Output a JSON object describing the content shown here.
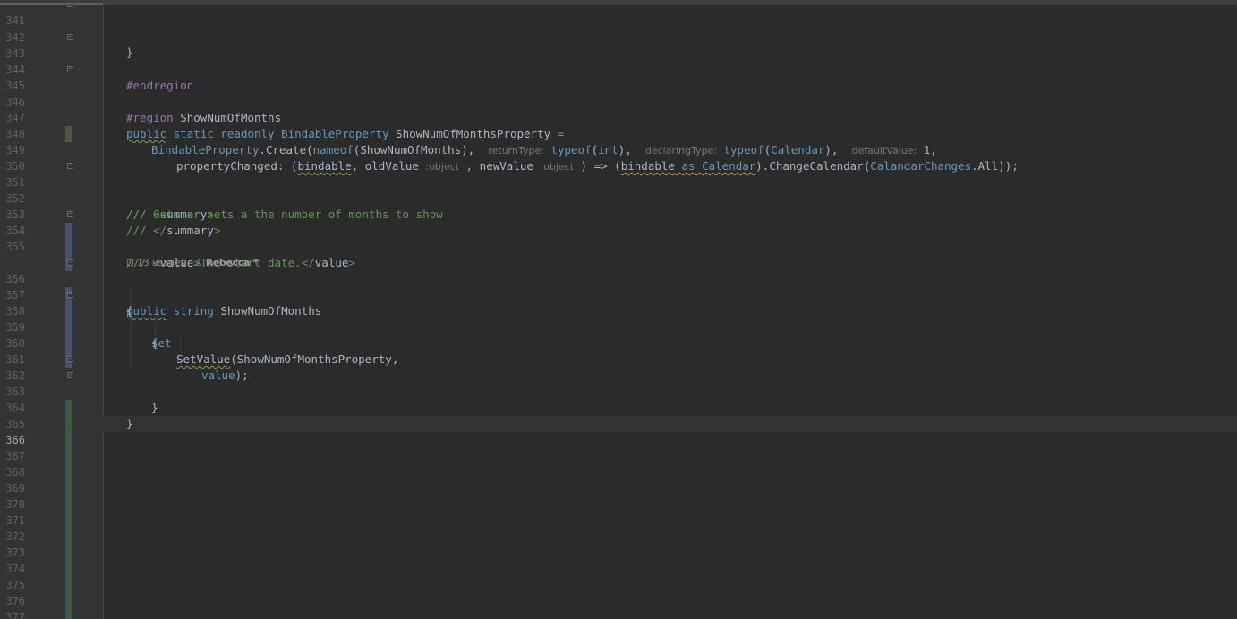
{
  "gutter": {
    "line_numbers": [
      "341",
      "342",
      "343",
      "344",
      "345",
      "346",
      "347",
      "348",
      "349",
      "350",
      "351",
      "352",
      "353",
      "354",
      "355",
      "356",
      "357",
      "358",
      "359",
      "360",
      "361",
      "362",
      "363",
      "364",
      "365",
      "366",
      "367",
      "368",
      "369",
      "370",
      "371",
      "372",
      "373",
      "374",
      "375",
      "376",
      "377",
      "378"
    ],
    "current_line": "366"
  },
  "code": {
    "l341": "}",
    "l343": "#endregion",
    "l345_kw": "#region",
    "l345_name": " ShowNumOfMonths",
    "l347_public": "public",
    "l347_static": " static",
    "l347_readonly": " readonly",
    "l347_type": " BindableProperty",
    "l347_name": " ShowNumOfMonthsProperty",
    "l347_eq": " =",
    "l348_cls": "BindableProperty",
    "l348_create": ".Create(",
    "l348_nameof": "nameof",
    "l348_arg": "(ShowNumOfMonths),",
    "l348_hint1": "returnType:",
    "l348_typeof1": "typeof",
    "l348_int_open": "(",
    "l348_int": "int",
    "l348_int_close": "),",
    "l348_hint2": "declaringType:",
    "l348_typeof2": "typeof",
    "l348_cal_open": "(",
    "l348_cal": "Calendar",
    "l348_cal_close": "),",
    "l348_hint3": "defaultValue:",
    "l348_default": "1",
    "l348_comma": ",",
    "l349_prop": "propertyChanged: (",
    "l349_bindable": "bindable",
    "l349_old": ", oldValue",
    "l349_hint_old": ":object",
    "l349_new": " , newValue",
    "l349_hint_new": ":object",
    "l349_arrow": " ) => (",
    "l349_bindable2": "bindable",
    "l349_as": "as",
    "l349_calendar": "Calendar",
    "l349_change": ").ChangeCalendar(",
    "l349_changes": "CalandarChanges",
    "l349_all": ".All));",
    "l351_slash": "/// ",
    "l351_tag": "<summary>",
    "l351_open": "<",
    "l351_tagname": "summary",
    "l351_close": ">",
    "l352": "/// Gets or sets a the number of months to show",
    "l353_slash": "/// ",
    "l353_open": "</",
    "l353_tagname": "summary",
    "l353_close": ">",
    "l354_slash": "/// ",
    "l354_open": "<",
    "l354_tagname": "value",
    "l354_close": ">",
    "l354_text": "The start date.",
    "l354_open2": "</",
    "l354_tagname2": "value",
    "l354_close2": ">",
    "lens_icon": "⊡",
    "lens_usages": "13 usages",
    "lens_author_icon": "♙",
    "lens_author": "Rebecca *",
    "l356_public": "public",
    "l356_string": " string",
    "l356_name": " ShowNumOfMonths",
    "l357": "{",
    "l358": "set",
    "l359": "{",
    "l360_fn": "SetValue",
    "l360_args": "(ShowNumOfMonthsProperty,",
    "l361_value": "value",
    "l361_end": ");",
    "l362": "}",
    "l363": "}"
  }
}
